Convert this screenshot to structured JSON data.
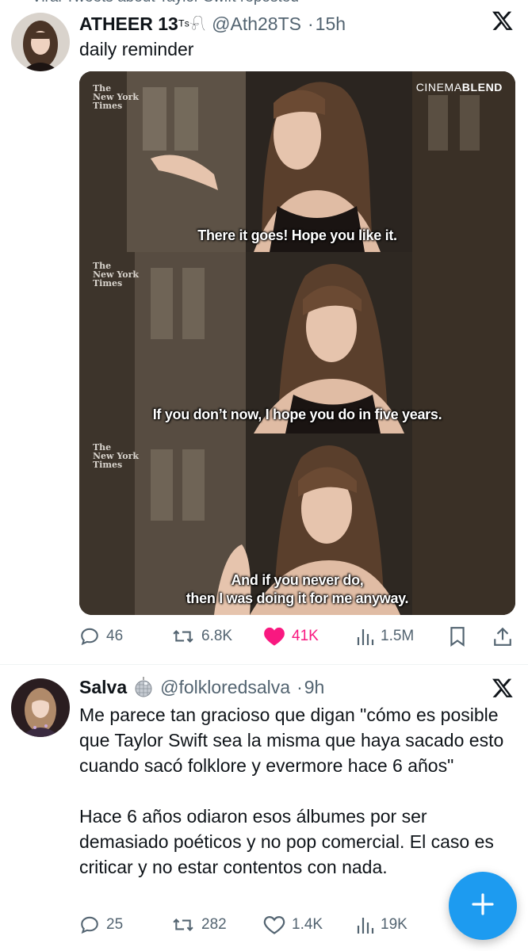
{
  "repost_header": {
    "text": "Viral Tweets about Taylor Swift reposted"
  },
  "tweet1": {
    "display_name": "ATHEER 13",
    "name_suffix": "ᵀˢ𓍯",
    "handle": "@Ath28TS",
    "separator": "·",
    "time": "15h",
    "text": "daily reminder",
    "media": {
      "watermark_brand": "CINEMA",
      "watermark_brand_bold": "BLEND",
      "nyt_logo_line1": "The",
      "nyt_logo_line2": "New York",
      "nyt_logo_line3": "Times",
      "captions": [
        "There it goes! Hope you like it.",
        "If you don’t now, I hope you do in five years.",
        "And if you never do,",
        "then I was doing it for me anyway."
      ]
    },
    "actions": {
      "replies": "46",
      "reposts": "6.8K",
      "likes": "41K",
      "views": "1.5M",
      "liked": true
    }
  },
  "tweet2": {
    "display_name": "Salva",
    "handle": "@folkloredsalva",
    "separator": "·",
    "time": "9h",
    "text_p1": "Me parece tan gracioso que digan \"cómo es posible que Taylor Swift sea la misma que haya sacado esto cuando sacó folklore y evermore hace 6 años\"",
    "text_p2": "Hace 6 años odiaron esos álbumes por ser demasiado poéticos y no pop comercial. El caso es criticar y no estar contentos con nada.",
    "actions": {
      "replies": "25",
      "reposts": "282",
      "likes": "1.4K",
      "views": "19K"
    }
  },
  "icons": {
    "reply": "reply-icon",
    "repost": "repost-icon",
    "like": "heart-icon",
    "views": "views-icon",
    "bookmark": "bookmark-icon",
    "share": "share-icon",
    "x": "x-logo-icon",
    "compose": "plus-icon",
    "disco": "disco-ball-icon"
  },
  "colors": {
    "like_active": "#f91880",
    "muted": "#536471",
    "accent": "#1d9bf0"
  }
}
